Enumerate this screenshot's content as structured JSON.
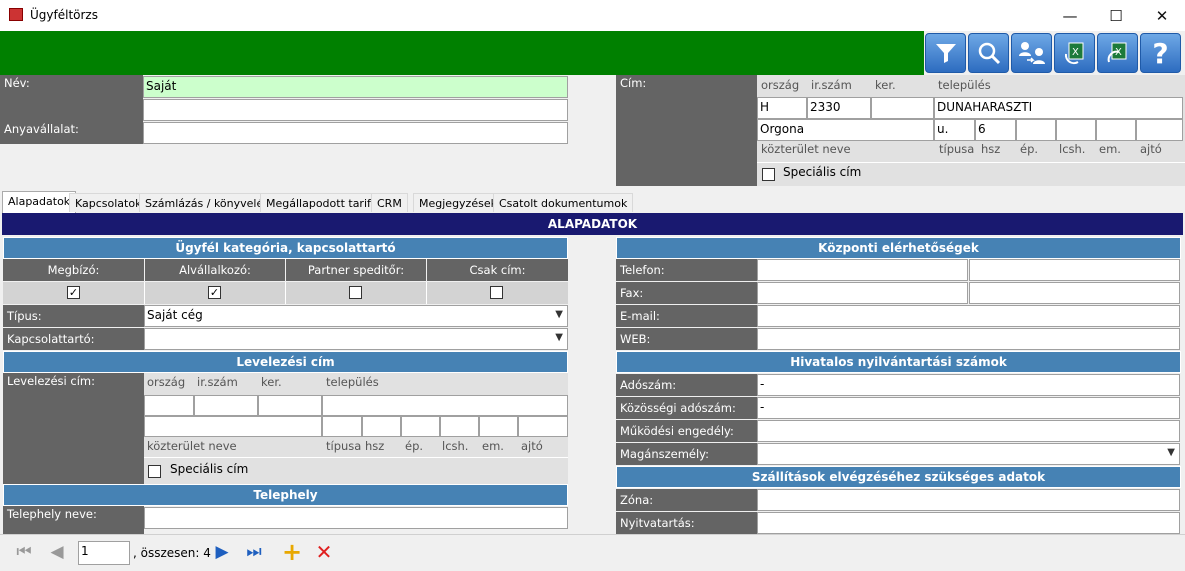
{
  "window": {
    "title": "Ügyféltörzs",
    "minimize": "—",
    "maximize": "☐",
    "close": "✕"
  },
  "toolbar": [
    "filter-icon",
    "search-icon",
    "users-transfer-icon",
    "excel-import-icon",
    "excel-export-icon",
    "help-icon"
  ],
  "top": {
    "nev_label": "Név:",
    "nev_value": "Saját",
    "anyavallalat_label": "Anyavállalat:",
    "cim_label": "Cím:",
    "cim_headers": {
      "orszag": "ország",
      "irszam": "ir.szám",
      "ker": "ker.",
      "telepules": "település"
    },
    "cim_orszag": "H",
    "cim_irszam": "2330",
    "cim_telepules": "DUNAHARASZTI",
    "cim_kozterulet": "Orgona",
    "cim_tipusa": "u.",
    "cim_hsz": "6",
    "cim_foot": {
      "kozterulet_neve": "közterület neve",
      "tipusa": "típusa",
      "hsz": "hsz",
      "ep": "ép.",
      "lcsh": "lcsh.",
      "em": "em.",
      "ajto": "ajtó"
    },
    "specialis_cim": "Speciális cím"
  },
  "tabs": [
    "Alapadatok",
    "Kapcsolatok",
    "Számlázás / könyvelés",
    "Megállapodott tarifák",
    "CRM",
    "Megjegyzések",
    "Csatolt dokumentumok"
  ],
  "section_title": "ALAPADATOK",
  "left": {
    "kat_header": "Ügyfél kategória, kapcsolattartó",
    "kat_cols": [
      "Megbízó:",
      "Alvállalkozó:",
      "Partner speditőr:",
      "Csak cím:"
    ],
    "kat_checked": [
      true,
      true,
      false,
      false
    ],
    "tipus_label": "Típus:",
    "tipus_value": "Saját cég",
    "kapcsolattarto_label": "Kapcsolattartó:",
    "level_header": "Levelezési cím",
    "level_label": "Levelezési cím:",
    "level_headers": {
      "orszag": "ország",
      "irszam": "ir.szám",
      "ker": "ker.",
      "telepules": "település"
    },
    "level_foot": {
      "kozterulet_neve": "közterület neve",
      "tipusa": "típusa",
      "hsz": "hsz",
      "ep": "ép.",
      "lcsh": "lcsh.",
      "em": "em.",
      "ajto": "ajtó"
    },
    "specialis_cim": "Speciális cím",
    "telephely_header": "Telephely",
    "telephely_label": "Telephely neve:"
  },
  "right": {
    "kozponti_header": "Központi elérhetőségek",
    "telefon": "Telefon:",
    "fax": "Fax:",
    "email": "E-mail:",
    "web": "WEB:",
    "hivatalos_header": "Hivatalos nyilvántartási számok",
    "adoszam": "Adószám:",
    "adoszam_value": "-",
    "kozossegi": "Közösségi adószám:",
    "kozossegi_value": "-",
    "mukodesi": "Működési engedély:",
    "maganszemely": "Magánszemély:",
    "szallitas_header": "Szállítások elvégzéséhez szükséges adatok",
    "zona": "Zóna:",
    "nyitvatartas": "Nyitvatartás:"
  },
  "nav": {
    "position": "1",
    "total_text": ", összesen: 4"
  }
}
